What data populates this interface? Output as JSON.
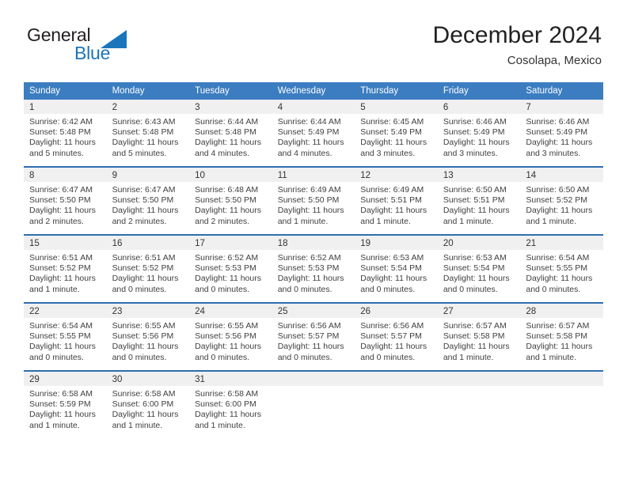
{
  "brand": {
    "name_part1": "General",
    "name_part2": "Blue",
    "logo_icon": "triangle-logo-icon"
  },
  "header": {
    "title": "December 2024",
    "subtitle": "Cosolapa, Mexico"
  },
  "colors": {
    "header_blue": "#3b7dc0",
    "row_divider_blue": "#2f6ead",
    "brand_blue": "#1b75bb",
    "daynum_band": "#f0f0f0",
    "text": "#404040"
  },
  "calendar": {
    "weekday_headers": [
      "Sunday",
      "Monday",
      "Tuesday",
      "Wednesday",
      "Thursday",
      "Friday",
      "Saturday"
    ],
    "weeks": [
      [
        {
          "day": "1",
          "sunrise": "Sunrise: 6:42 AM",
          "sunset": "Sunset: 5:48 PM",
          "daylight_line1": "Daylight: 11 hours",
          "daylight_line2": "and 5 minutes."
        },
        {
          "day": "2",
          "sunrise": "Sunrise: 6:43 AM",
          "sunset": "Sunset: 5:48 PM",
          "daylight_line1": "Daylight: 11 hours",
          "daylight_line2": "and 5 minutes."
        },
        {
          "day": "3",
          "sunrise": "Sunrise: 6:44 AM",
          "sunset": "Sunset: 5:48 PM",
          "daylight_line1": "Daylight: 11 hours",
          "daylight_line2": "and 4 minutes."
        },
        {
          "day": "4",
          "sunrise": "Sunrise: 6:44 AM",
          "sunset": "Sunset: 5:49 PM",
          "daylight_line1": "Daylight: 11 hours",
          "daylight_line2": "and 4 minutes."
        },
        {
          "day": "5",
          "sunrise": "Sunrise: 6:45 AM",
          "sunset": "Sunset: 5:49 PM",
          "daylight_line1": "Daylight: 11 hours",
          "daylight_line2": "and 3 minutes."
        },
        {
          "day": "6",
          "sunrise": "Sunrise: 6:46 AM",
          "sunset": "Sunset: 5:49 PM",
          "daylight_line1": "Daylight: 11 hours",
          "daylight_line2": "and 3 minutes."
        },
        {
          "day": "7",
          "sunrise": "Sunrise: 6:46 AM",
          "sunset": "Sunset: 5:49 PM",
          "daylight_line1": "Daylight: 11 hours",
          "daylight_line2": "and 3 minutes."
        }
      ],
      [
        {
          "day": "8",
          "sunrise": "Sunrise: 6:47 AM",
          "sunset": "Sunset: 5:50 PM",
          "daylight_line1": "Daylight: 11 hours",
          "daylight_line2": "and 2 minutes."
        },
        {
          "day": "9",
          "sunrise": "Sunrise: 6:47 AM",
          "sunset": "Sunset: 5:50 PM",
          "daylight_line1": "Daylight: 11 hours",
          "daylight_line2": "and 2 minutes."
        },
        {
          "day": "10",
          "sunrise": "Sunrise: 6:48 AM",
          "sunset": "Sunset: 5:50 PM",
          "daylight_line1": "Daylight: 11 hours",
          "daylight_line2": "and 2 minutes."
        },
        {
          "day": "11",
          "sunrise": "Sunrise: 6:49 AM",
          "sunset": "Sunset: 5:50 PM",
          "daylight_line1": "Daylight: 11 hours",
          "daylight_line2": "and 1 minute."
        },
        {
          "day": "12",
          "sunrise": "Sunrise: 6:49 AM",
          "sunset": "Sunset: 5:51 PM",
          "daylight_line1": "Daylight: 11 hours",
          "daylight_line2": "and 1 minute."
        },
        {
          "day": "13",
          "sunrise": "Sunrise: 6:50 AM",
          "sunset": "Sunset: 5:51 PM",
          "daylight_line1": "Daylight: 11 hours",
          "daylight_line2": "and 1 minute."
        },
        {
          "day": "14",
          "sunrise": "Sunrise: 6:50 AM",
          "sunset": "Sunset: 5:52 PM",
          "daylight_line1": "Daylight: 11 hours",
          "daylight_line2": "and 1 minute."
        }
      ],
      [
        {
          "day": "15",
          "sunrise": "Sunrise: 6:51 AM",
          "sunset": "Sunset: 5:52 PM",
          "daylight_line1": "Daylight: 11 hours",
          "daylight_line2": "and 1 minute."
        },
        {
          "day": "16",
          "sunrise": "Sunrise: 6:51 AM",
          "sunset": "Sunset: 5:52 PM",
          "daylight_line1": "Daylight: 11 hours",
          "daylight_line2": "and 0 minutes."
        },
        {
          "day": "17",
          "sunrise": "Sunrise: 6:52 AM",
          "sunset": "Sunset: 5:53 PM",
          "daylight_line1": "Daylight: 11 hours",
          "daylight_line2": "and 0 minutes."
        },
        {
          "day": "18",
          "sunrise": "Sunrise: 6:52 AM",
          "sunset": "Sunset: 5:53 PM",
          "daylight_line1": "Daylight: 11 hours",
          "daylight_line2": "and 0 minutes."
        },
        {
          "day": "19",
          "sunrise": "Sunrise: 6:53 AM",
          "sunset": "Sunset: 5:54 PM",
          "daylight_line1": "Daylight: 11 hours",
          "daylight_line2": "and 0 minutes."
        },
        {
          "day": "20",
          "sunrise": "Sunrise: 6:53 AM",
          "sunset": "Sunset: 5:54 PM",
          "daylight_line1": "Daylight: 11 hours",
          "daylight_line2": "and 0 minutes."
        },
        {
          "day": "21",
          "sunrise": "Sunrise: 6:54 AM",
          "sunset": "Sunset: 5:55 PM",
          "daylight_line1": "Daylight: 11 hours",
          "daylight_line2": "and 0 minutes."
        }
      ],
      [
        {
          "day": "22",
          "sunrise": "Sunrise: 6:54 AM",
          "sunset": "Sunset: 5:55 PM",
          "daylight_line1": "Daylight: 11 hours",
          "daylight_line2": "and 0 minutes."
        },
        {
          "day": "23",
          "sunrise": "Sunrise: 6:55 AM",
          "sunset": "Sunset: 5:56 PM",
          "daylight_line1": "Daylight: 11 hours",
          "daylight_line2": "and 0 minutes."
        },
        {
          "day": "24",
          "sunrise": "Sunrise: 6:55 AM",
          "sunset": "Sunset: 5:56 PM",
          "daylight_line1": "Daylight: 11 hours",
          "daylight_line2": "and 0 minutes."
        },
        {
          "day": "25",
          "sunrise": "Sunrise: 6:56 AM",
          "sunset": "Sunset: 5:57 PM",
          "daylight_line1": "Daylight: 11 hours",
          "daylight_line2": "and 0 minutes."
        },
        {
          "day": "26",
          "sunrise": "Sunrise: 6:56 AM",
          "sunset": "Sunset: 5:57 PM",
          "daylight_line1": "Daylight: 11 hours",
          "daylight_line2": "and 0 minutes."
        },
        {
          "day": "27",
          "sunrise": "Sunrise: 6:57 AM",
          "sunset": "Sunset: 5:58 PM",
          "daylight_line1": "Daylight: 11 hours",
          "daylight_line2": "and 1 minute."
        },
        {
          "day": "28",
          "sunrise": "Sunrise: 6:57 AM",
          "sunset": "Sunset: 5:58 PM",
          "daylight_line1": "Daylight: 11 hours",
          "daylight_line2": "and 1 minute."
        }
      ],
      [
        {
          "day": "29",
          "sunrise": "Sunrise: 6:58 AM",
          "sunset": "Sunset: 5:59 PM",
          "daylight_line1": "Daylight: 11 hours",
          "daylight_line2": "and 1 minute."
        },
        {
          "day": "30",
          "sunrise": "Sunrise: 6:58 AM",
          "sunset": "Sunset: 6:00 PM",
          "daylight_line1": "Daylight: 11 hours",
          "daylight_line2": "and 1 minute."
        },
        {
          "day": "31",
          "sunrise": "Sunrise: 6:58 AM",
          "sunset": "Sunset: 6:00 PM",
          "daylight_line1": "Daylight: 11 hours",
          "daylight_line2": "and 1 minute."
        },
        {
          "day": "",
          "sunrise": "",
          "sunset": "",
          "daylight_line1": "",
          "daylight_line2": ""
        },
        {
          "day": "",
          "sunrise": "",
          "sunset": "",
          "daylight_line1": "",
          "daylight_line2": ""
        },
        {
          "day": "",
          "sunrise": "",
          "sunset": "",
          "daylight_line1": "",
          "daylight_line2": ""
        },
        {
          "day": "",
          "sunrise": "",
          "sunset": "",
          "daylight_line1": "",
          "daylight_line2": ""
        }
      ]
    ]
  }
}
